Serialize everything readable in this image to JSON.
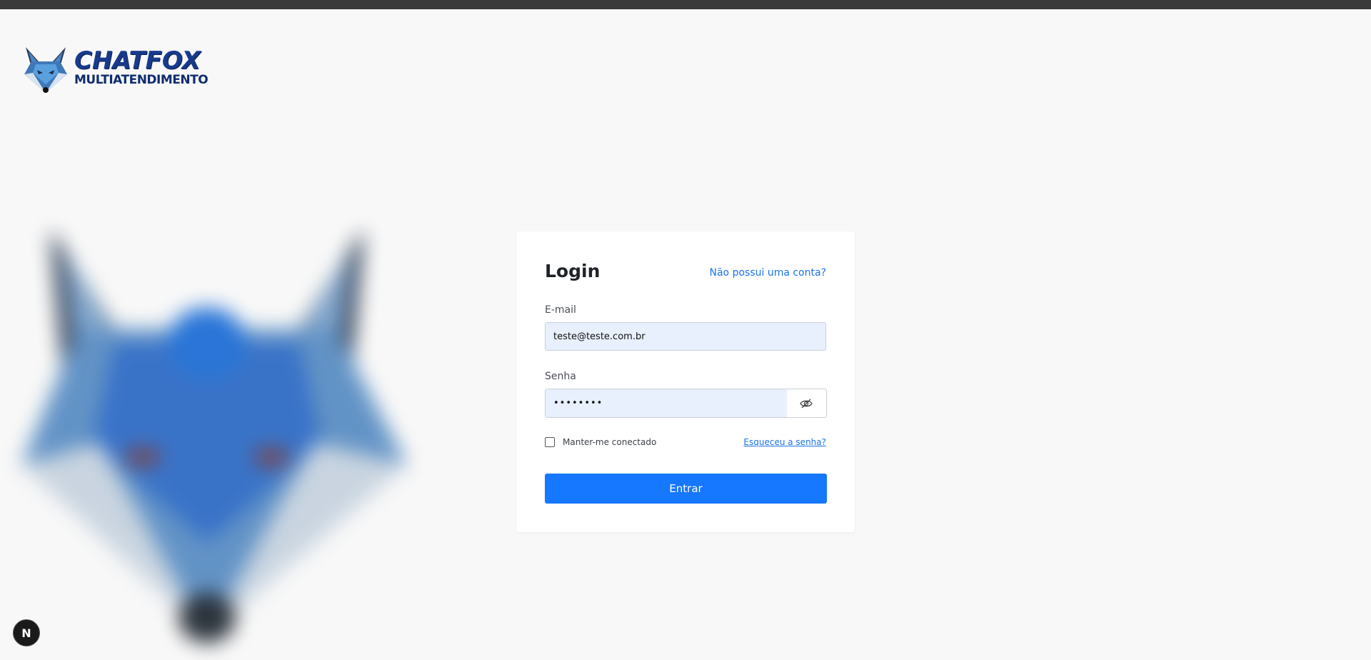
{
  "brand": {
    "title": "CHATFOX",
    "subtitle": "MULTIATENDIMENTO",
    "primary_color": "#1677ff"
  },
  "login": {
    "title": "Login",
    "signup_link": "Não possui uma conta?",
    "email_label": "E-mail",
    "email_value": "teste@teste.com.br",
    "password_label": "Senha",
    "password_value": "••••••••",
    "remember_label": "Manter-me conectado",
    "remember_checked": false,
    "forgot_link": "Esqueceu a senha?",
    "submit_label": "Entrar"
  },
  "dev_badge": {
    "label": "N"
  }
}
